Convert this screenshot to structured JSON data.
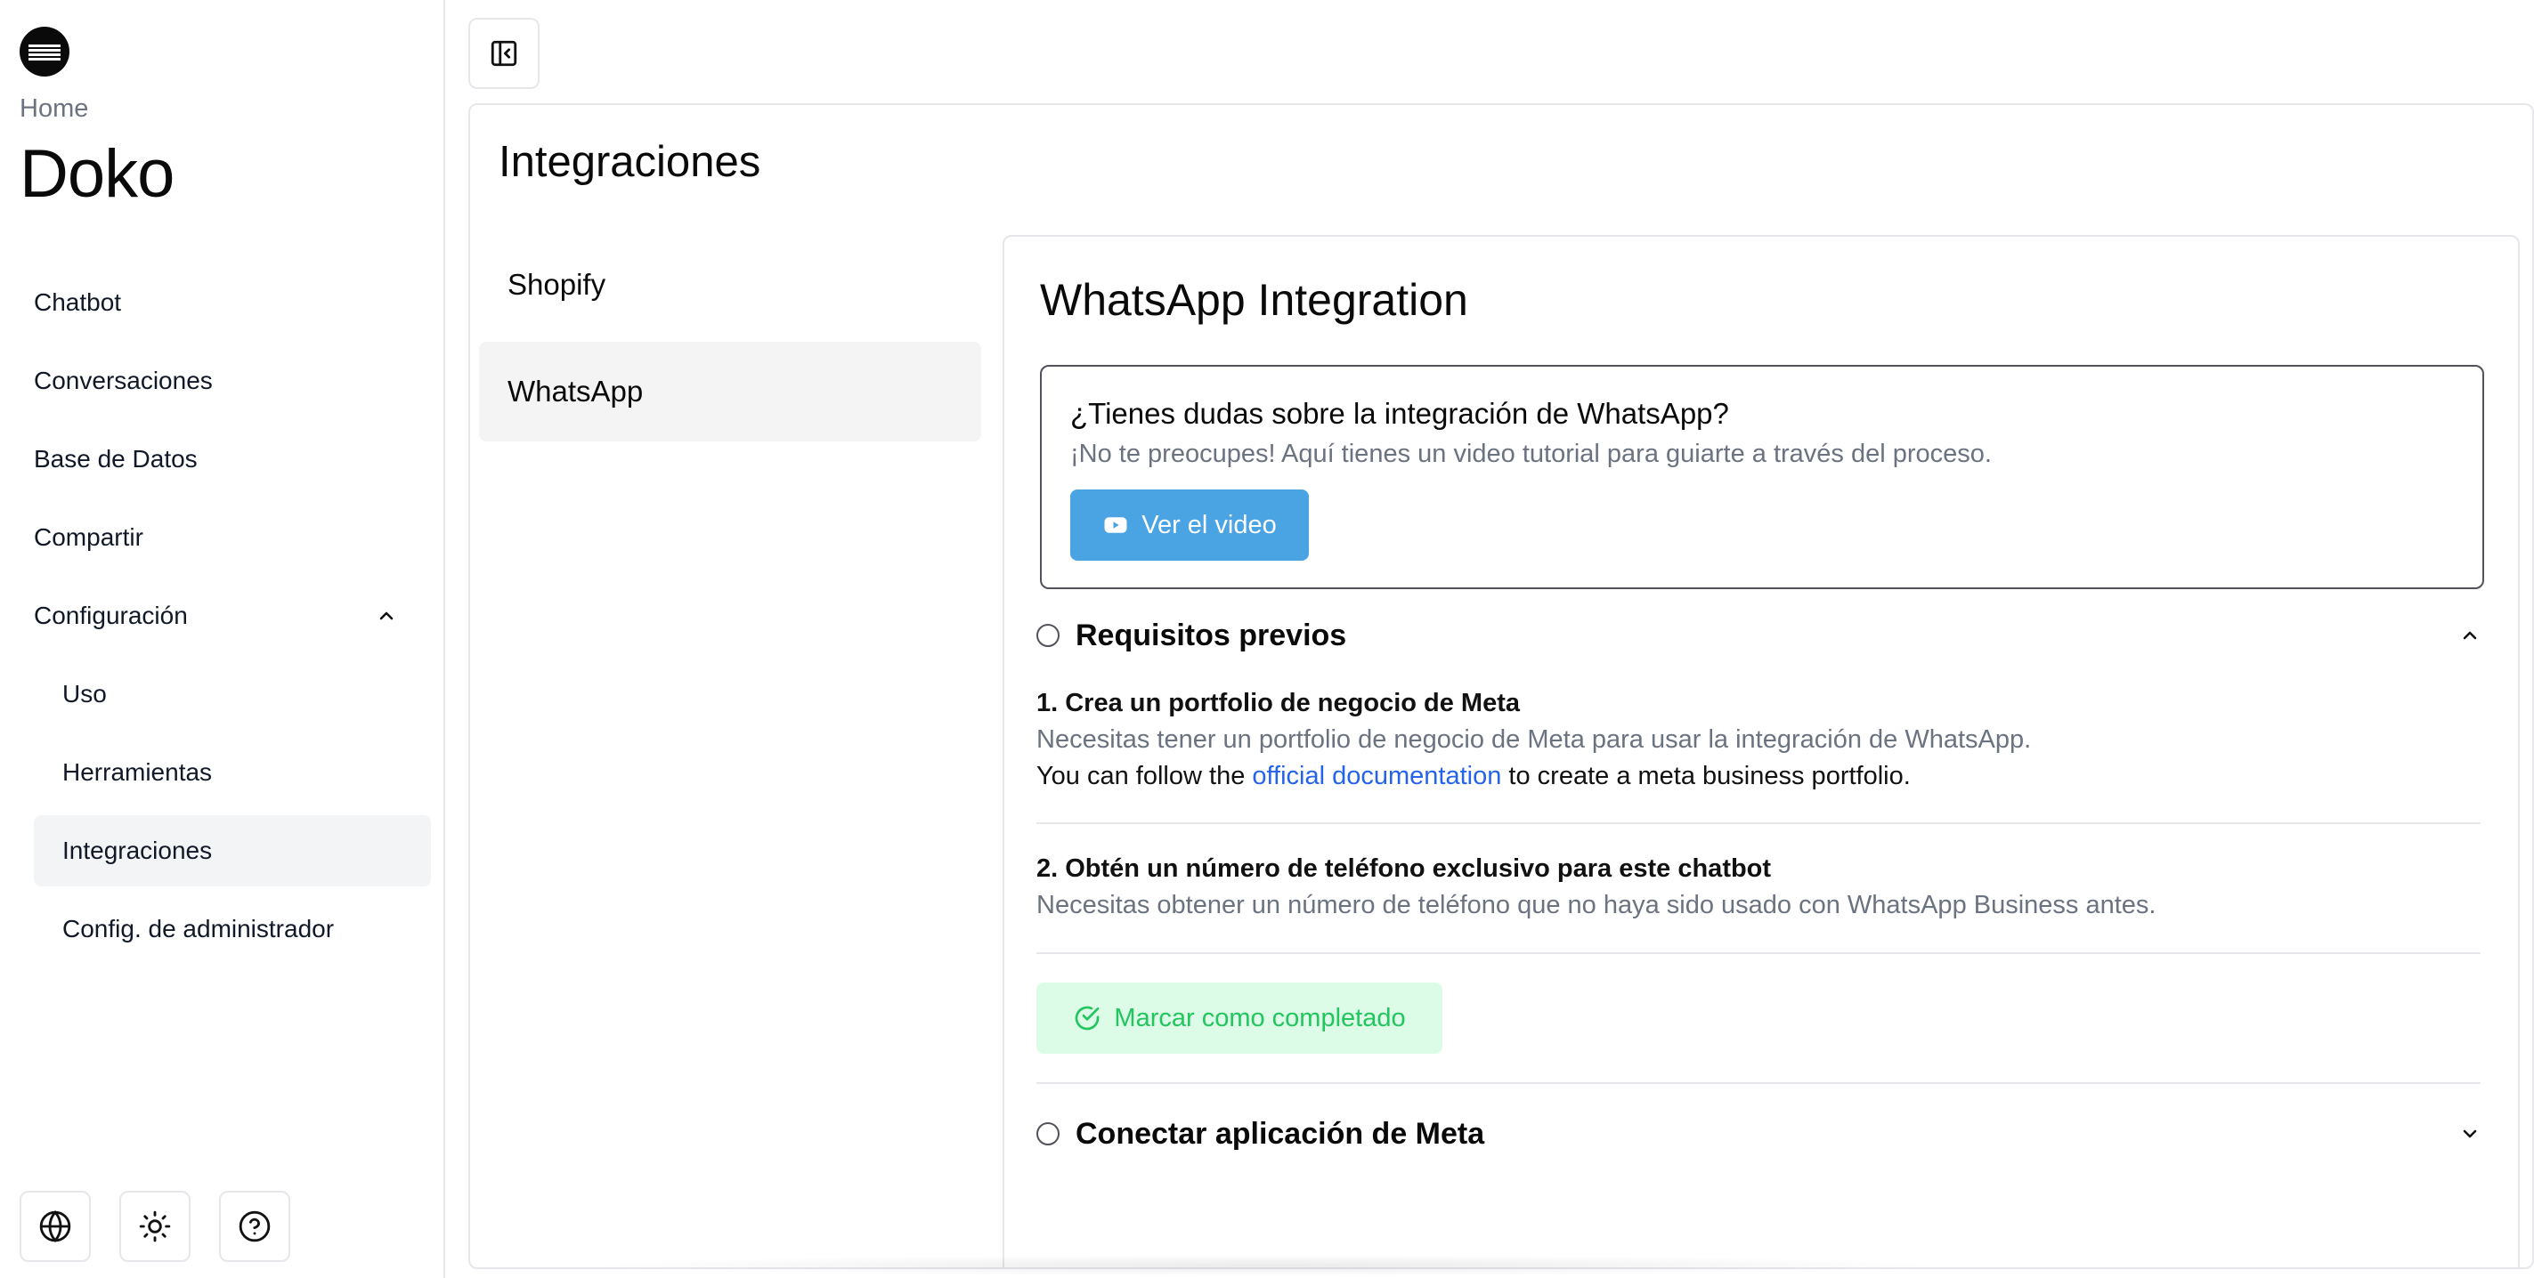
{
  "sidebar": {
    "breadcrumb": "Home",
    "brand": "Doko",
    "nav": [
      {
        "label": "Chatbot"
      },
      {
        "label": "Conversaciones"
      },
      {
        "label": "Base de Datos"
      },
      {
        "label": "Compartir"
      }
    ],
    "config": {
      "label": "Configuración",
      "expanded": true,
      "items": [
        {
          "label": "Uso"
        },
        {
          "label": "Herramientas"
        },
        {
          "label": "Integraciones",
          "active": true
        },
        {
          "label": "Config. de administrador"
        }
      ]
    },
    "footer_icons": [
      "globe-icon",
      "sun-icon",
      "help-circle-icon"
    ]
  },
  "topbar": {
    "toggle_icon": "sidebar-toggle-icon"
  },
  "main": {
    "title": "Integraciones",
    "tabs": [
      {
        "label": "Shopify"
      },
      {
        "label": "WhatsApp",
        "active": true
      }
    ],
    "integration": {
      "title": "WhatsApp Integration",
      "help": {
        "question": "¿Tienes dudas sobre la integración de WhatsApp?",
        "subtitle": "¡No te preocupes! Aquí tienes un video tutorial para guiarte a través del proceso.",
        "button": "Ver el video",
        "button_icon": "youtube-icon",
        "button_color": "#4aa3e2"
      },
      "sections": [
        {
          "label": "Requisitos previos",
          "expanded": true,
          "steps": [
            {
              "title": "1. Crea un portfolio de negocio de Meta",
              "desc": "Necesitas tener un portfolio de negocio de Meta para usar la integración de WhatsApp.",
              "extra_pre": "You can follow the ",
              "extra_link": "official documentation",
              "extra_post": " to create a meta business portfolio."
            },
            {
              "title": "2. Obtén un número de teléfono exclusivo para este chatbot",
              "desc": "Necesitas obtener un número de teléfono que no haya sido usado con WhatsApp Business antes."
            }
          ],
          "complete_button": "Marcar como completado",
          "complete_color": "#22c55e"
        },
        {
          "label": "Conectar aplicación de Meta",
          "expanded": false
        }
      ]
    }
  }
}
